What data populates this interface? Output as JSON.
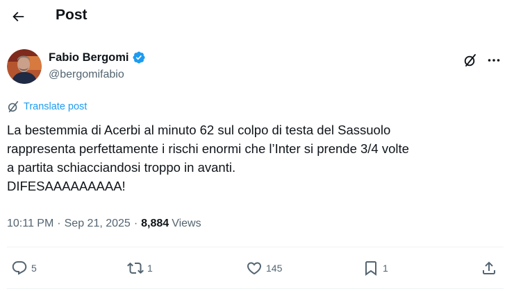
{
  "header": {
    "title": "Post",
    "back_icon": "arrow-left-icon"
  },
  "author": {
    "display_name": "Fabio Bergomi",
    "handle": "@bergomifabio",
    "verified": true,
    "verified_color": "#1d9bf0"
  },
  "translate": {
    "label": "Translate post",
    "icon": "grok-icon"
  },
  "tweet": {
    "lines": [
      "La bestemmia di Acerbi al minuto 62 sul colpo di testa del Sassuolo",
      "rappresenta perfettamente i rischi enormi che l’Inter si prende 3/4 volte",
      "a partita schiacciandosi troppo in avanti.",
      "DIFESAAAAAAAAA!"
    ]
  },
  "meta": {
    "time": "10:11 PM",
    "separator": "·",
    "date": "Sep 21, 2025",
    "views_count": "8,884",
    "views_label": "Views"
  },
  "actions": {
    "replies": "5",
    "reposts": "1",
    "likes": "145",
    "bookmarks": "1"
  },
  "colors": {
    "accent": "#1d9bf0",
    "secondary_text": "#536471",
    "primary_text": "#0f1419"
  }
}
